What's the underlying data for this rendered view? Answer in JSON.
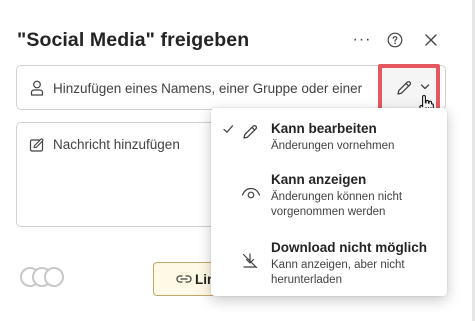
{
  "dialog": {
    "title": "\"Social Media\" freigeben",
    "more_label": "···"
  },
  "share": {
    "placeholder": "Hinzufügen eines Namens, einer Gruppe oder einer"
  },
  "message": {
    "placeholder": "Nachricht hinzufügen"
  },
  "footer": {
    "link_label": "Lin"
  },
  "permission_menu": {
    "items": [
      {
        "title": "Kann bearbeiten",
        "subtitle": "Änderungen vornehmen",
        "selected": true,
        "icon": "pencil-icon"
      },
      {
        "title": "Kann anzeigen",
        "subtitle": "Änderungen können nicht vorgenommen werden",
        "selected": false,
        "icon": "eye-icon"
      },
      {
        "title": "Download nicht möglich",
        "subtitle": "Kann anzeigen, aber nicht herunterladen",
        "selected": false,
        "icon": "no-download-icon"
      }
    ]
  },
  "colors": {
    "highlight_border": "#e5585f",
    "link_button_border": "#c4a66a"
  }
}
